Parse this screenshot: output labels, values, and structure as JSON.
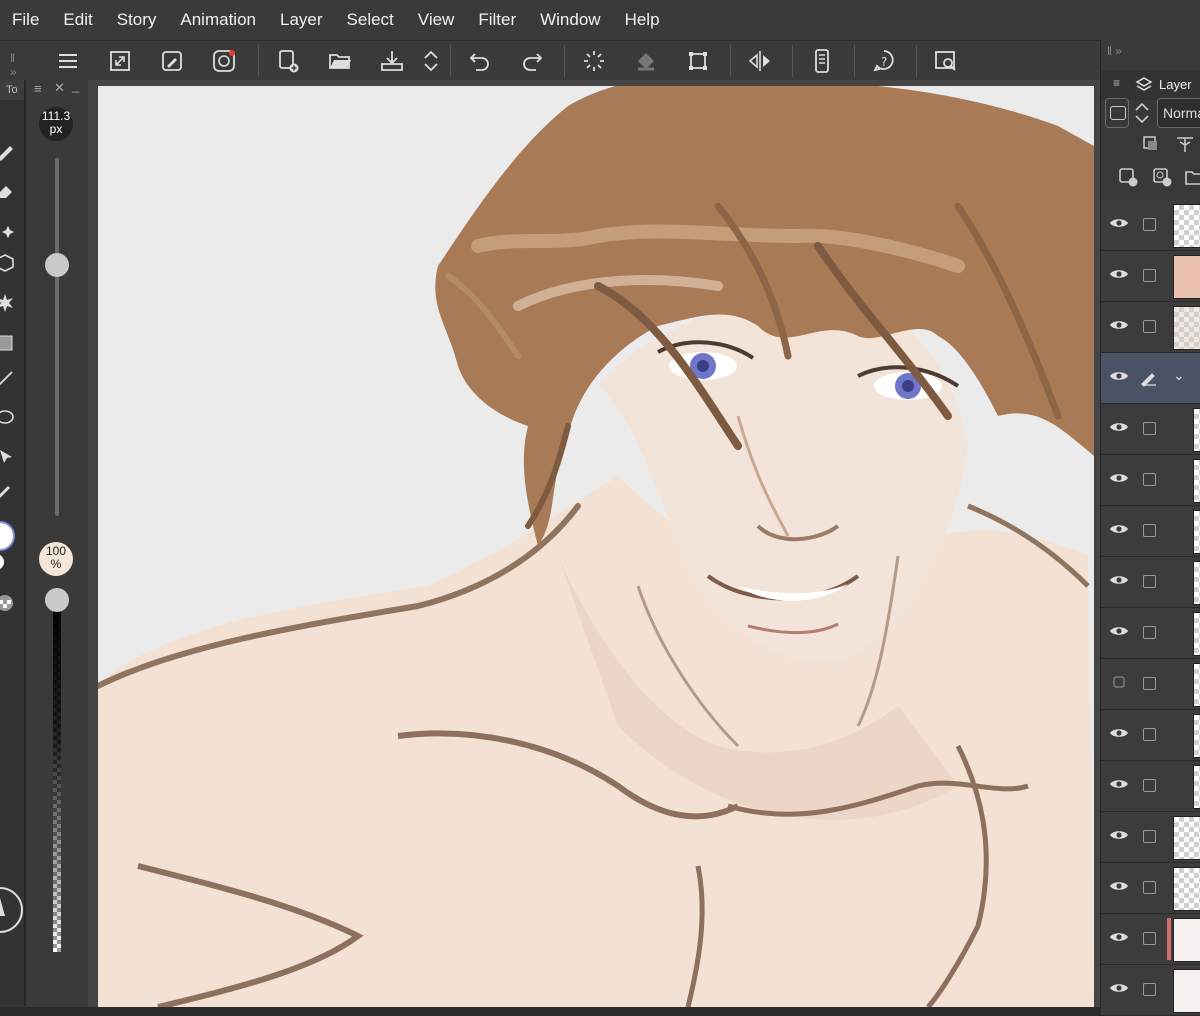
{
  "menu": [
    "File",
    "Edit",
    "Story",
    "Animation",
    "Layer",
    "Select",
    "View",
    "Filter",
    "Window",
    "Help"
  ],
  "toolbar": {
    "icons": [
      "menu-icon",
      "fit-canvas-icon",
      "eyedropper-icon",
      "spiral-icon",
      "new-file-icon",
      "open-folder-icon",
      "save-icon",
      "expand-icon",
      "undo-icon",
      "redo-icon",
      "loading-icon",
      "fill-icon",
      "transform-icon",
      "flip-icon",
      "smartphone-icon",
      "help-icon",
      "search-window-icon"
    ]
  },
  "tools_panel": {
    "header": "To"
  },
  "brush": {
    "size_value": "111.3",
    "size_unit": "px",
    "opacity_value": "100",
    "opacity_unit": "%",
    "size_level": 0.7,
    "opacity_level": 1.0
  },
  "layer_panel": {
    "tab_label": "Layer",
    "blend_mode": "Norma",
    "layers": [
      {
        "visible": true,
        "thumb": "transparent"
      },
      {
        "visible": true,
        "thumb": "skin"
      },
      {
        "visible": true,
        "thumb": "hair"
      },
      {
        "visible": true,
        "thumb": "folder",
        "selected": true
      },
      {
        "visible": true,
        "thumb": "transparent"
      },
      {
        "visible": true,
        "thumb": "transparent"
      },
      {
        "visible": true,
        "thumb": "transparent"
      },
      {
        "visible": true,
        "thumb": "transparent"
      },
      {
        "visible": true,
        "thumb": "transparent"
      },
      {
        "visible": false,
        "thumb": "transparent"
      },
      {
        "visible": true,
        "thumb": "transparent"
      },
      {
        "visible": true,
        "thumb": "transparent"
      },
      {
        "visible": true,
        "thumb": "transparent"
      },
      {
        "visible": true,
        "thumb": "sketch"
      },
      {
        "visible": true,
        "thumb": "paper"
      },
      {
        "visible": true,
        "thumb": "paper"
      }
    ]
  },
  "colors": {
    "accent_selected": "#4a5366",
    "canvas_bg": "#ecebeb",
    "hair": "#a97a56",
    "skin": "#f3e2d4"
  }
}
